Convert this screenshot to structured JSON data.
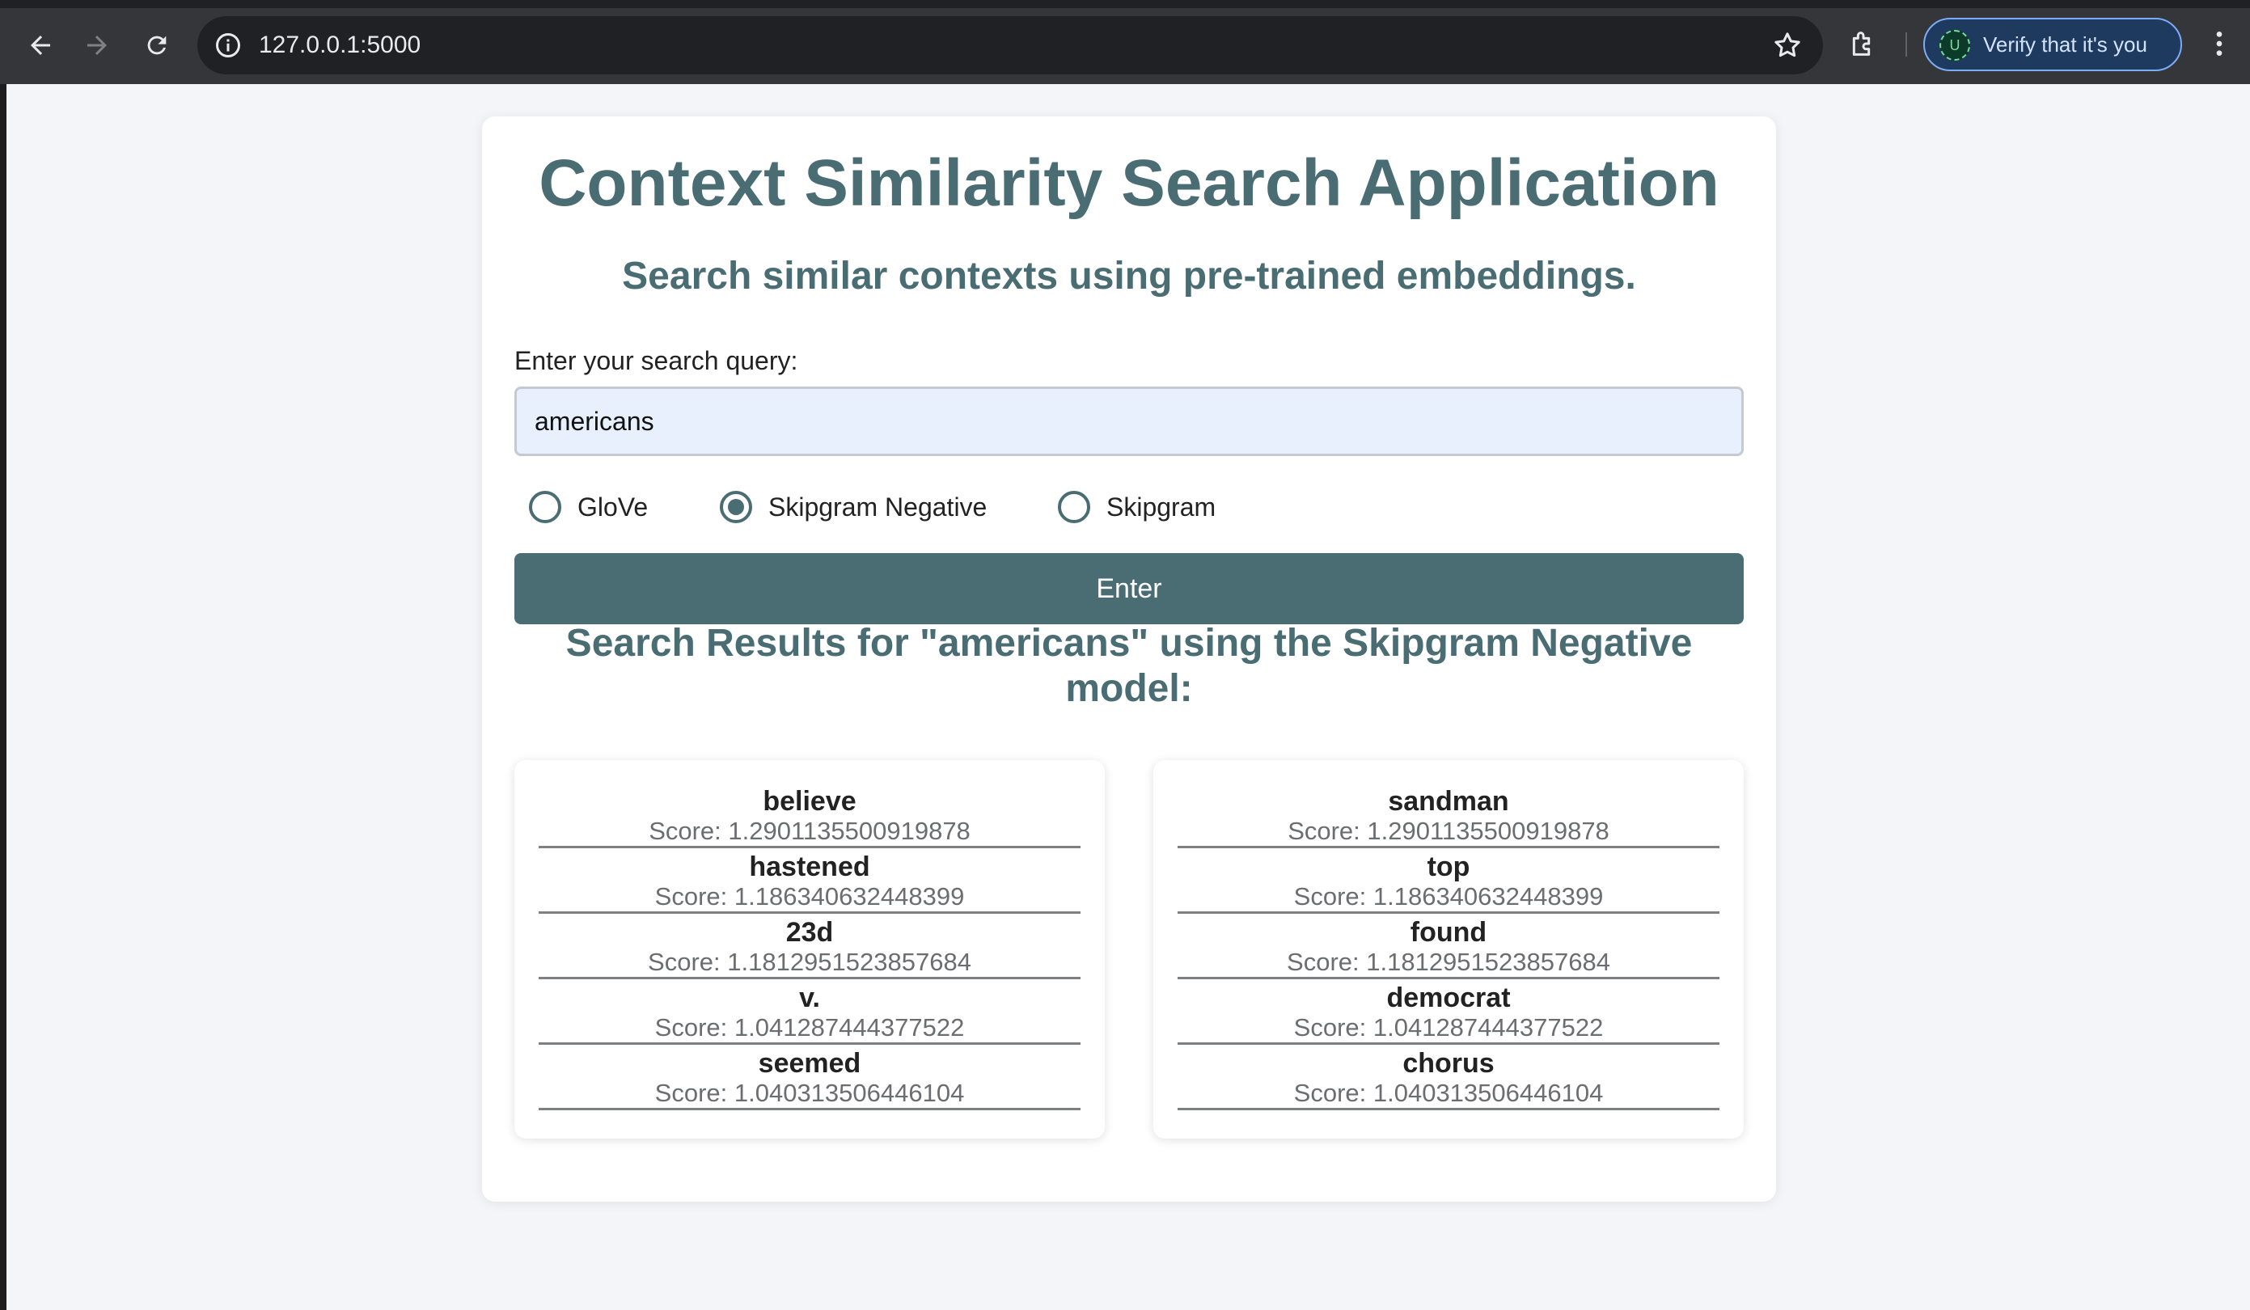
{
  "browser": {
    "url": "127.0.0.1:5000",
    "verify_label": "Verify that it's you",
    "avatar_letter": "U"
  },
  "page": {
    "title": "Context Similarity Search Application",
    "subtitle": "Search similar contexts using pre-trained embeddings.",
    "query_label": "Enter your search query:",
    "query_value": "americans",
    "models": [
      {
        "label": "GloVe",
        "checked": false
      },
      {
        "label": "Skipgram Negative",
        "checked": true
      },
      {
        "label": "Skipgram",
        "checked": false
      }
    ],
    "enter_label": "Enter",
    "results_heading": "Search Results for \"americans\" using the Skipgram Negative model:"
  },
  "results": {
    "left": [
      {
        "word": "believe",
        "score": "Score: 1.2901135500919878"
      },
      {
        "word": "hastened",
        "score": "Score: 1.186340632448399"
      },
      {
        "word": "23d",
        "score": "Score: 1.1812951523857684"
      },
      {
        "word": "v.",
        "score": "Score: 1.041287444377522"
      },
      {
        "word": "seemed",
        "score": "Score: 1.040313506446104"
      }
    ],
    "right": [
      {
        "word": "sandman",
        "score": "Score: 1.2901135500919878"
      },
      {
        "word": "top",
        "score": "Score: 1.186340632448399"
      },
      {
        "word": "found",
        "score": "Score: 1.1812951523857684"
      },
      {
        "word": "democrat",
        "score": "Score: 1.041287444377522"
      },
      {
        "word": "chorus",
        "score": "Score: 1.040313506446104"
      }
    ]
  },
  "icons": [
    "back-icon",
    "forward-icon",
    "reload-icon",
    "info-icon",
    "star-icon",
    "extensions-icon",
    "more-vert-icon"
  ]
}
